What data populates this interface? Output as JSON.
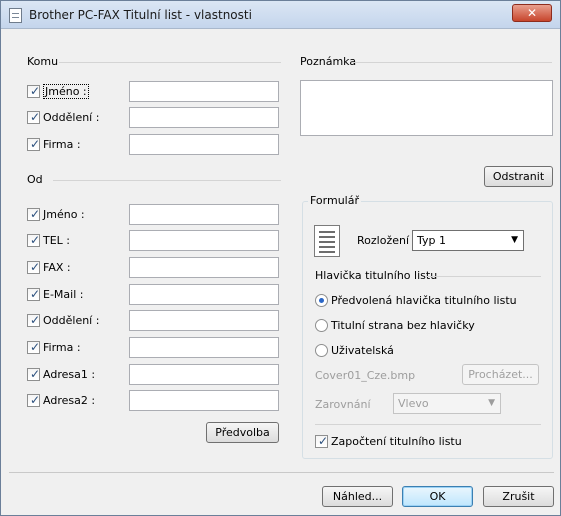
{
  "window": {
    "title": "Brother PC-FAX Titulní list - vlastnosti",
    "close_symbol": "✕"
  },
  "komu": {
    "label": "Komu",
    "fields": [
      {
        "label": "Jméno :",
        "checked": true,
        "value": ""
      },
      {
        "label": "Oddělení :",
        "checked": true,
        "value": ""
      },
      {
        "label": "Firma :",
        "checked": true,
        "value": ""
      }
    ]
  },
  "od": {
    "label": "Od",
    "fields": [
      {
        "label": "Jméno :",
        "checked": true,
        "value": ""
      },
      {
        "label": "TEL :",
        "checked": true,
        "value": ""
      },
      {
        "label": "FAX :",
        "checked": true,
        "value": ""
      },
      {
        "label": "E-Mail :",
        "checked": true,
        "value": ""
      },
      {
        "label": "Oddělení :",
        "checked": true,
        "value": ""
      },
      {
        "label": "Firma :",
        "checked": true,
        "value": ""
      },
      {
        "label": "Adresa1 :",
        "checked": true,
        "value": ""
      },
      {
        "label": "Adresa2 :",
        "checked": true,
        "value": ""
      }
    ],
    "predvolba_label": "Předvolba"
  },
  "poznamka": {
    "label": "Poznámka",
    "value": "",
    "odstranit_label": "Odstranit"
  },
  "formular": {
    "label": "Formulář",
    "rozlozeni_label": "Rozložení",
    "rozlozeni_value": "Typ 1",
    "hlavicka_label": "Hlavička titulního listu",
    "radios": [
      {
        "label": "Předvolená hlavička titulního listu",
        "selected": true
      },
      {
        "label": "Titulní strana bez hlavičky",
        "selected": false
      },
      {
        "label": "Uživatelská",
        "selected": false
      }
    ],
    "file_value": "Cover01_Cze.bmp",
    "prochazet_label": "Procházet...",
    "zarovnani_label": "Zarovnání",
    "zarovnani_value": "Vlevo",
    "zapocteni_label": "Započtení titulního listu",
    "zapocteni_checked": true
  },
  "footer": {
    "nahled_label": "Náhled...",
    "ok_label": "OK",
    "zrusit_label": "Zrušit"
  },
  "symbols": {
    "check": "✓",
    "dropdown": "▼"
  }
}
